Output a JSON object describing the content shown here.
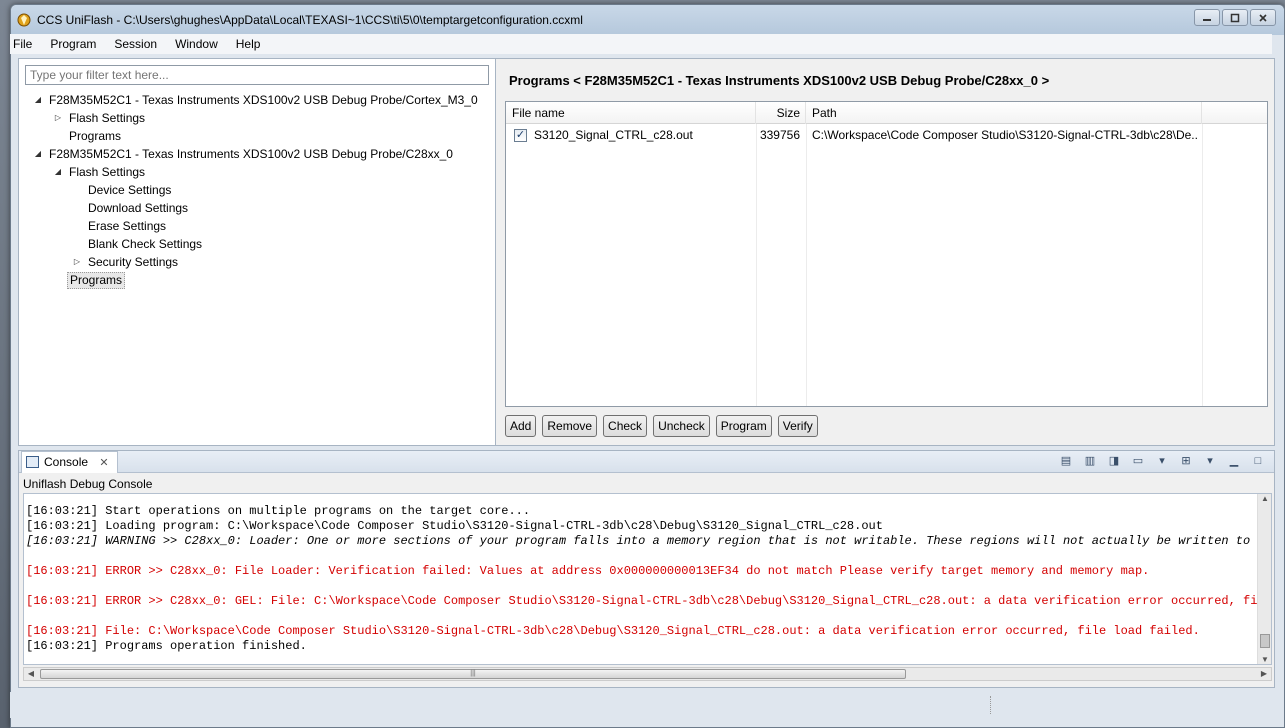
{
  "window": {
    "title": "CCS UniFlash - C:\\Users\\ghughes\\AppData\\Local\\TEXASI~1\\CCS\\ti\\5\\0\\temptargetconfiguration.ccxml"
  },
  "menu": [
    "File",
    "Program",
    "Session",
    "Window",
    "Help"
  ],
  "filter": {
    "placeholder": "Type your filter text here..."
  },
  "tree": [
    {
      "label": "F28M35M52C1 - Texas Instruments XDS100v2 USB Debug Probe/Cortex_M3_0",
      "twisty": "expanded"
    },
    {
      "label": "Flash Settings",
      "twisty": "collapsed"
    },
    {
      "label": "Programs",
      "twisty": "none"
    },
    {
      "label": "F28M35M52C1 - Texas Instruments XDS100v2 USB Debug Probe/C28xx_0",
      "twisty": "expanded"
    },
    {
      "label": "Flash Settings",
      "twisty": "expanded"
    },
    {
      "label": "Device Settings",
      "twisty": "none"
    },
    {
      "label": "Download Settings",
      "twisty": "none"
    },
    {
      "label": "Erase Settings",
      "twisty": "none"
    },
    {
      "label": "Blank Check Settings",
      "twisty": "none"
    },
    {
      "label": "Security Settings",
      "twisty": "collapsed"
    },
    {
      "label": "Programs",
      "twisty": "none",
      "selected": true
    }
  ],
  "programs_panel": {
    "title": "Programs < F28M35M52C1 - Texas Instruments XDS100v2 USB Debug Probe/C28xx_0 >",
    "columns": [
      "File name",
      "Size",
      "Path"
    ],
    "rows": [
      {
        "checked": true,
        "file_name": "S3120_Signal_CTRL_c28.out",
        "size": "339756",
        "path": "C:\\Workspace\\Code Composer Studio\\S3120-Signal-CTRL-3db\\c28\\De..."
      }
    ],
    "buttons": [
      "Add",
      "Remove",
      "Check",
      "Uncheck",
      "Program",
      "Verify"
    ]
  },
  "console": {
    "tab_label": "Console",
    "subtitle": "Uniflash Debug Console",
    "lines": [
      {
        "text": "[16:03:21] Start operations on multiple programs on the target core...",
        "kind": "normal"
      },
      {
        "text": "[16:03:21] Loading program: C:\\Workspace\\Code Composer Studio\\S3120-Signal-CTRL-3db\\c28\\Debug\\S3120_Signal_CTRL_c28.out",
        "kind": "normal"
      },
      {
        "text": "[16:03:21] WARNING >> C28xx_0: Loader: One or more sections of your program falls into a memory region that is not writable.  These regions will not actually be written to the",
        "kind": "warn"
      },
      {
        "text": "[16:03:21] ERROR >> C28xx_0: File Loader: Verification failed: Values at address 0x000000000013EF34 do not match Please verify target memory and memory map.",
        "kind": "err"
      },
      {
        "text": "[16:03:21] ERROR >> C28xx_0: GEL: File: C:\\Workspace\\Code Composer Studio\\S3120-Signal-CTRL-3db\\c28\\Debug\\S3120_Signal_CTRL_c28.out: a data verification error occurred, file lo",
        "kind": "err"
      },
      {
        "text": "[16:03:21] File: C:\\Workspace\\Code Composer Studio\\S3120-Signal-CTRL-3db\\c28\\Debug\\S3120_Signal_CTRL_c28.out: a data verification error occurred, file load failed.",
        "kind": "err"
      },
      {
        "text": "[16:03:21] Programs operation finished.",
        "kind": "normal"
      }
    ]
  }
}
